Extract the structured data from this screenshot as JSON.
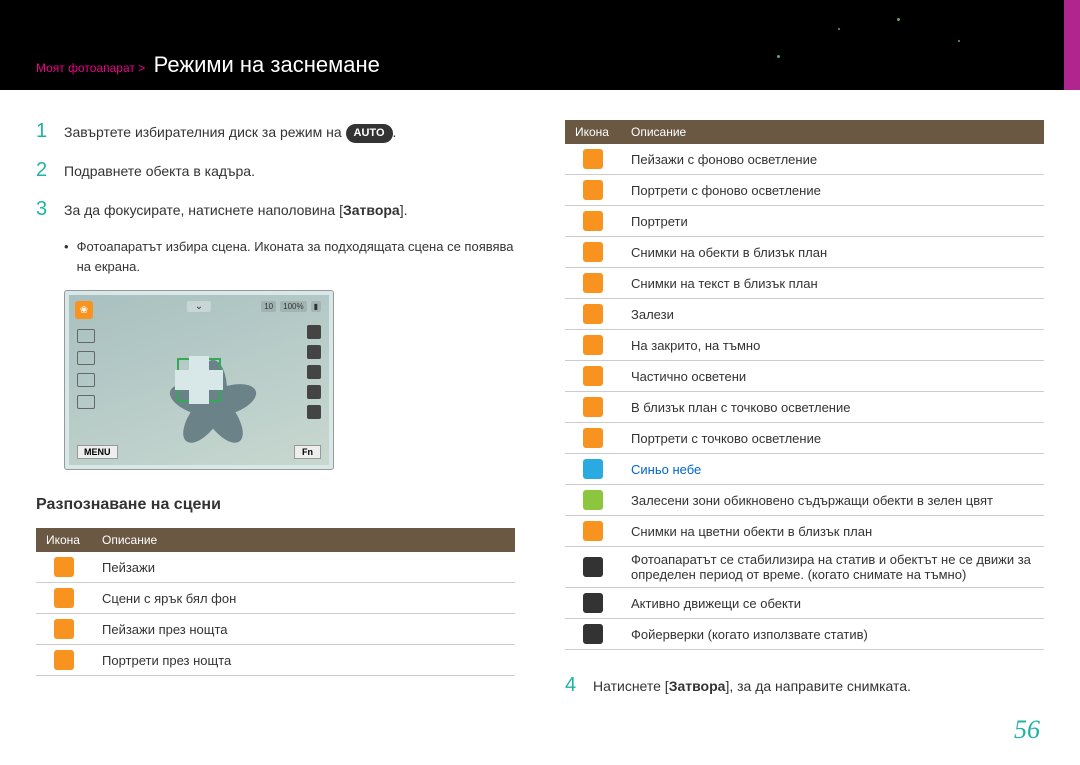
{
  "header": {
    "breadcrumb": "Моят фотоапарат >",
    "title": "Режими на заснемане"
  },
  "steps": {
    "s1": {
      "num": "1",
      "text_a": "Завъртете избирателния диск за режим на ",
      "auto": "AUTO",
      "text_b": "."
    },
    "s2": {
      "num": "2",
      "text": "Подравнете обекта в кадъра."
    },
    "s3": {
      "num": "3",
      "text_a": "За да фокусирате, натиснете наполовина [",
      "bold": "Затвора",
      "text_b": "]."
    },
    "bullet": "Фотоапаратът избира сцена. Иконата за подходящата сцена се появява на екрана.",
    "s4": {
      "num": "4",
      "text_a": "Натиснете [",
      "bold": "Затвора",
      "text_b": "], за да направите снимката."
    }
  },
  "screen": {
    "menu": "MENU",
    "fn": "Fn",
    "top_num": "10",
    "top_pct": "100%",
    "chev": "⌄"
  },
  "subtitle": "Разпознаване на сцени",
  "table_headers": {
    "icon": "Икона",
    "desc": "Описание"
  },
  "left_rows": [
    {
      "cls": "i-orange",
      "txt": "Пейзажи"
    },
    {
      "cls": "i-white",
      "txt": "Сцени с ярък бял фон"
    },
    {
      "cls": "i-orange",
      "txt": "Пейзажи през нощта"
    },
    {
      "cls": "i-orange",
      "txt": "Портрети през нощта"
    }
  ],
  "right_rows": [
    {
      "cls": "i-orange",
      "txt": "Пейзажи с фоново осветление"
    },
    {
      "cls": "i-orange",
      "txt": "Портрети с фоново осветление"
    },
    {
      "cls": "i-orange",
      "txt": "Портрети"
    },
    {
      "cls": "i-orange",
      "txt": "Снимки на обекти в близък план"
    },
    {
      "cls": "i-orange",
      "txt": "Снимки на текст в близък план"
    },
    {
      "cls": "i-orange",
      "txt": "Залези"
    },
    {
      "cls": "i-orange",
      "txt": "На закрито, на тъмно"
    },
    {
      "cls": "i-orange",
      "txt": "Частично осветени"
    },
    {
      "cls": "i-orange",
      "txt": "В близък план с точково осветление"
    },
    {
      "cls": "i-orange",
      "txt": "Портрети с точково осветление"
    },
    {
      "cls": "i-blue",
      "txt": "Синьо небе",
      "link": true
    },
    {
      "cls": "i-green",
      "txt": "Залесени зони обикновено съдържащи обекти в зелен цвят"
    },
    {
      "cls": "i-orange",
      "txt": "Снимки на цветни обекти в близък план"
    },
    {
      "cls": "i-dark",
      "txt": "Фотоапаратът се стабилизира на статив и обектът не се движи за определен период от време. (когато снимате на тъмно)"
    },
    {
      "cls": "i-dark",
      "txt": "Активно движещи се обекти"
    },
    {
      "cls": "i-dark",
      "txt": "Фойерверки (когато използвате статив)"
    }
  ],
  "page": "56"
}
